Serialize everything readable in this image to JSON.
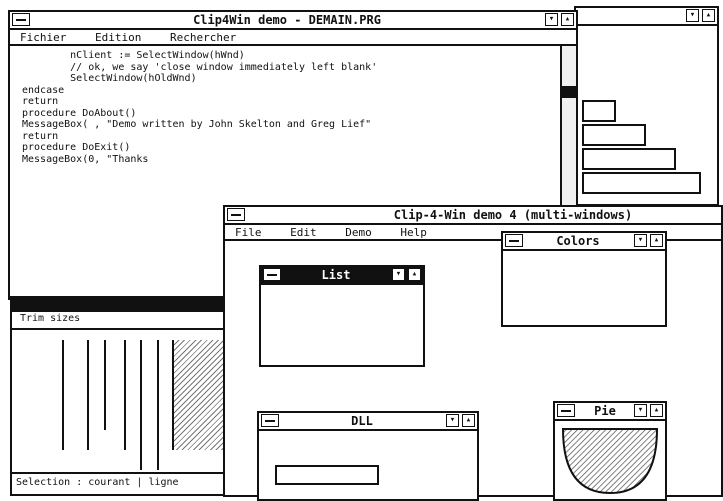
{
  "editor": {
    "title": "Clip4Win demo - DEMAIN.PRG",
    "menu": [
      "Fichier",
      "Edition",
      "Rechercher"
    ],
    "code_lines": [
      "        nClient := SelectWindow(hWnd)",
      "        // ok, we say 'close window immediately left blank'",
      "        SelectWindow(hOldWnd)",
      "endcase",
      "return",
      "",
      "",
      "procedure DoAbout()",
      "MessageBox( , \"Demo written by John Skelton and Greg Lief\"",
      "return",
      "",
      "",
      "procedure DoExit()",
      "MessageBox(0, \"Thanks"
    ]
  },
  "small_window": {
    "title": "Trim sizes"
  },
  "status_bar": {
    "text": "Selection : courant | ligne"
  },
  "demo_window": {
    "title": "Clip-4-Win demo 4 (multi-windows)",
    "menu": [
      "File",
      "Edit",
      "Demo",
      "Help"
    ],
    "child_list": {
      "title": "List"
    },
    "child_colors": {
      "title": "Colors"
    },
    "child_dll": {
      "title": "DLL"
    },
    "child_pie": {
      "title": "Pie"
    }
  }
}
